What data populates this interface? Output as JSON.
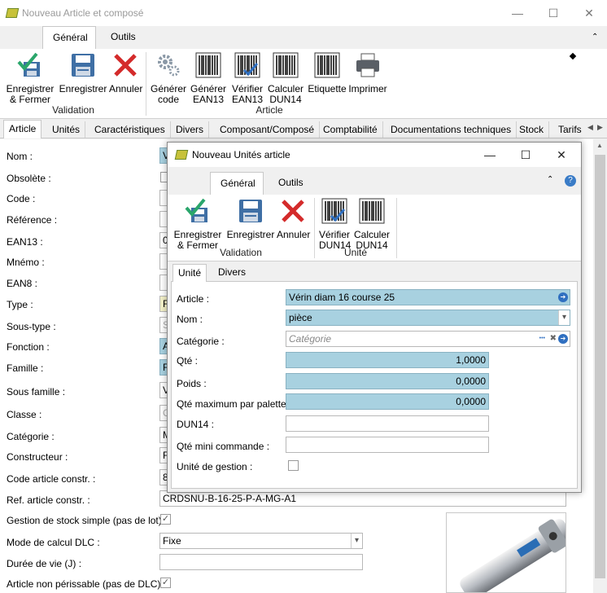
{
  "window": {
    "title": "Nouveau Article et composé",
    "minimize": "—",
    "maximize": "☐",
    "close": "✕"
  },
  "ribbon": {
    "tabs": [
      "Général",
      "Outils"
    ],
    "buttons": {
      "save_close": [
        "Enregistrer",
        "& Fermer"
      ],
      "save": "Enregistrer",
      "cancel": "Annuler",
      "gen_code": [
        "Générer",
        "code"
      ],
      "gen_ean13": [
        "Générer",
        "EAN13"
      ],
      "verify_ean13": [
        "Vérifier",
        "EAN13"
      ],
      "calc_dun14": [
        "Calculer",
        "DUN14"
      ],
      "label": "Etiquette",
      "print": "Imprimer"
    },
    "groups": {
      "validation": "Validation",
      "article": "Article"
    }
  },
  "tabs": [
    "Article",
    "Unités",
    "Caractéristiques",
    "Divers",
    "Composant/Composé",
    "Comptabilité",
    "Documentations techniques",
    "Stock",
    "Tarifs"
  ],
  "form": {
    "labels": {
      "nom": "Nom :",
      "obsolete": "Obsolète :",
      "code": "Code :",
      "reference": "Référence :",
      "ean13": "EAN13 :",
      "mnemo": "Mnémo :",
      "ean8": "EAN8 :",
      "type": "Type :",
      "sous_type": "Sous-type :",
      "fonction": "Fonction :",
      "famille": "Famille :",
      "sous_famille": "Sous famille :",
      "classe": "Classe :",
      "categorie": "Catégorie :",
      "constructeur": "Constructeur :",
      "code_constr": "Code article constr. :",
      "ref_constr": "Ref. article constr. :",
      "gestion_stock": "Gestion de stock simple (pas de lot) :",
      "mode_dlc": "Mode de calcul DLC :",
      "duree_vie": "Durée de vie (J) :",
      "non_perissable": "Article non périssable (pas de DLC) :"
    },
    "partials": {
      "nom": "V",
      "ean13": "0",
      "type": "F",
      "sous_type": "S",
      "fonction": "A",
      "famille": "F",
      "sous_famille": "V",
      "classe": "C",
      "categorie": "M",
      "constructeur": "F",
      "code_constr": "8"
    },
    "values": {
      "ref_constr": "CRDSNU-B-16-25-P-A-MG-A1",
      "mode_dlc": "Fixe",
      "duree_vie": ""
    }
  },
  "dialog": {
    "title": "Nouveau Unités article",
    "ribbon_tabs": [
      "Général",
      "Outils"
    ],
    "buttons": {
      "save_close": [
        "Enregistrer",
        "& Fermer"
      ],
      "save": "Enregistrer",
      "cancel": "Annuler",
      "verify_dun14": [
        "Vérifier",
        "DUN14"
      ],
      "calc_dun14": [
        "Calculer",
        "DUN14"
      ]
    },
    "groups": {
      "validation": "Validation",
      "unite": "Unité"
    },
    "tabs": [
      "Unité",
      "Divers"
    ],
    "labels": {
      "article": "Article :",
      "nom": "Nom :",
      "categorie": "Catégorie :",
      "qte": "Qté :",
      "poids": "Poids :",
      "qte_max_palette": "Qté maximum par palette :",
      "dun14": "DUN14 :",
      "qte_mini": "Qté mini commande :",
      "unite_gestion": "Unité de gestion :"
    },
    "values": {
      "article": "Vérin diam 16 course 25",
      "nom": "pièce",
      "categorie_placeholder": "Catégorie",
      "qte": "1,0000",
      "poids": "0,0000",
      "qte_max_palette": "0,0000",
      "dun14": "",
      "qte_mini": ""
    }
  },
  "icons": {
    "check": "✓",
    "dropdown": "▾",
    "ellipsis": "•••",
    "clear": "✖",
    "go": "➔"
  },
  "colors": {
    "highlight_field": "#a8d1e0",
    "save_blue": "#3f6fa5",
    "cancel_red": "#d42b2b",
    "check_green": "#2aa66b"
  }
}
